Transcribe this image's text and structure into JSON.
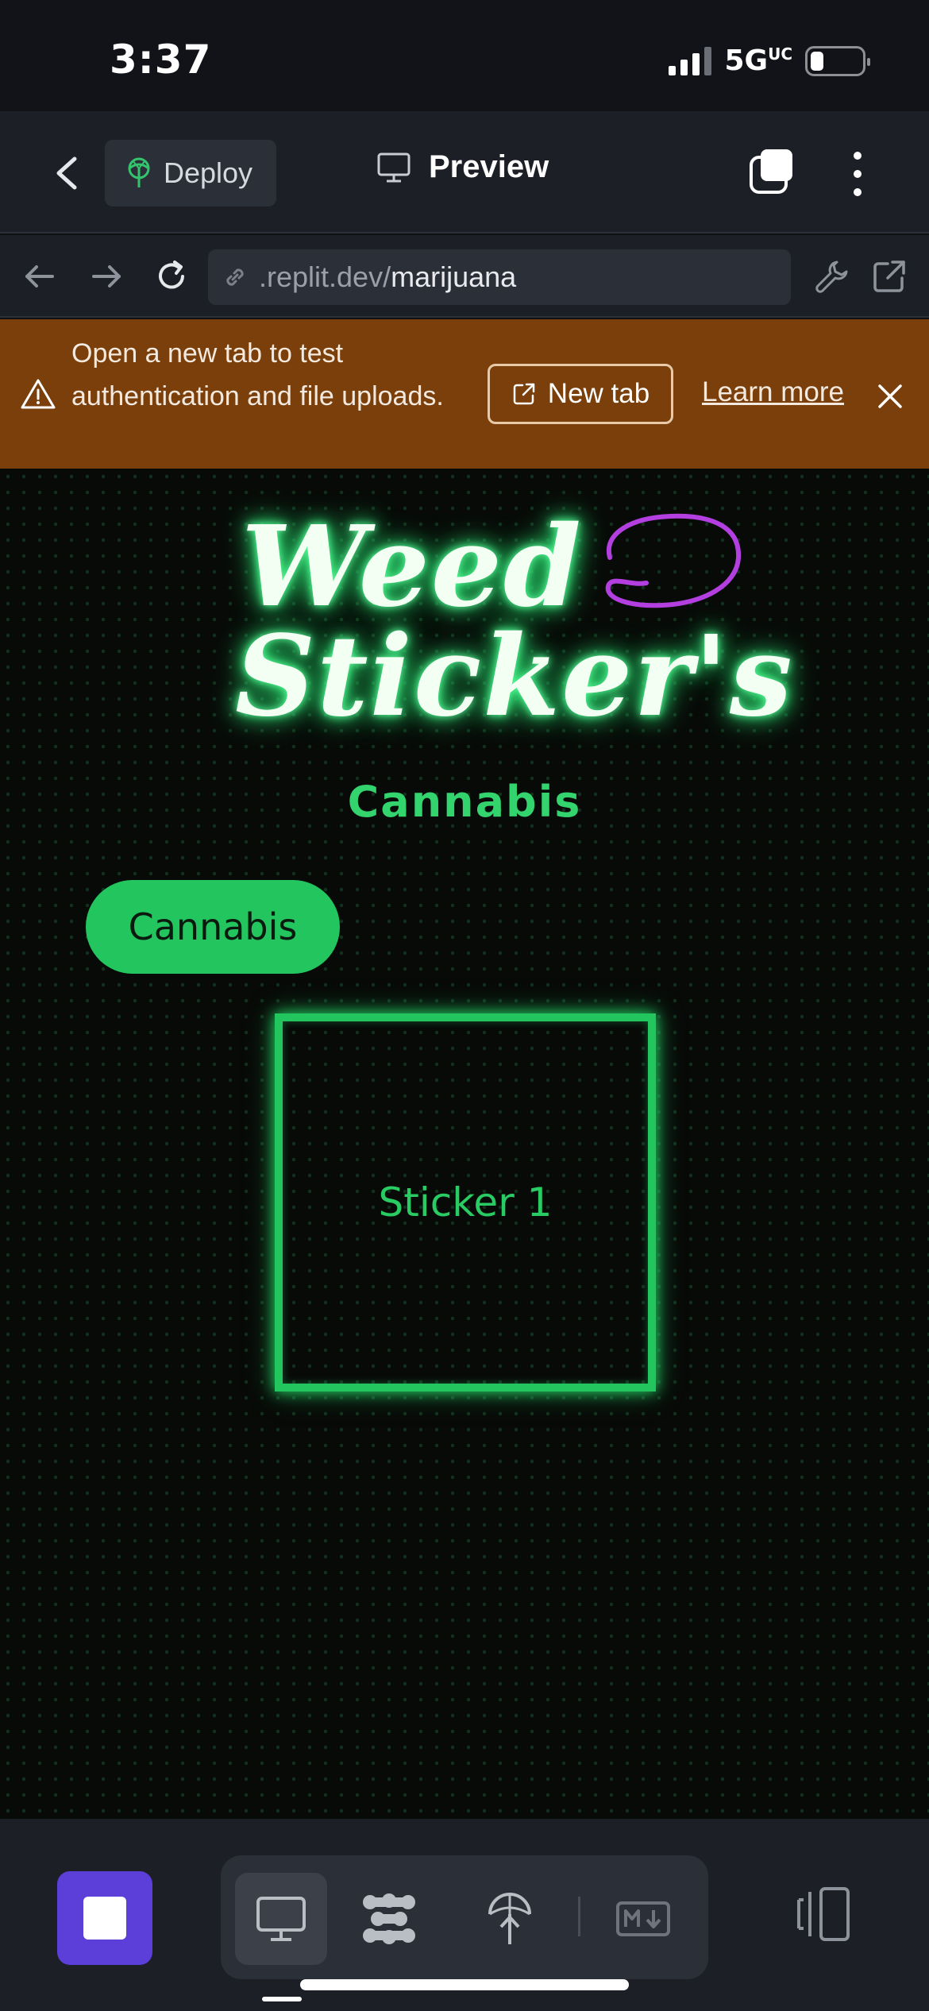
{
  "status_bar": {
    "time": "3:37",
    "network": "5G",
    "network_suffix": "UC",
    "battery_level": 0.25
  },
  "toolbar": {
    "back_icon": "chevron-left-icon",
    "deploy_label": "Deploy",
    "deploy_icon": "deploy-icon",
    "preview_label": "Preview",
    "preview_icon": "monitor-icon",
    "tabs_icon": "tabs-icon",
    "more_icon": "more-vertical-icon"
  },
  "urlbar": {
    "url_host": ".replit.dev/",
    "url_path": "marijuana",
    "icons": [
      "arrow-left-icon",
      "arrow-right-icon",
      "reload-icon",
      "link-icon",
      "wrench-icon",
      "external-link-icon"
    ]
  },
  "banner": {
    "message": "Open a new tab to test authentication and file uploads.",
    "new_tab_label": "New tab",
    "learn_more_label": "Learn more",
    "background": "#7a3f0a"
  },
  "app": {
    "logo_line1": "Weed",
    "logo_line2": "Sticker's",
    "subtitle": "Cannabis",
    "button_label": "Cannabis",
    "sticker_label": "Sticker 1",
    "accent": "#22c55e"
  },
  "bottom_bar": {
    "stop_color": "#5b3fd8",
    "tools": [
      "monitor-icon",
      "workflow-icon",
      "deploy-icon",
      "markdown-icon"
    ],
    "panel_icon": "panel-icon"
  }
}
